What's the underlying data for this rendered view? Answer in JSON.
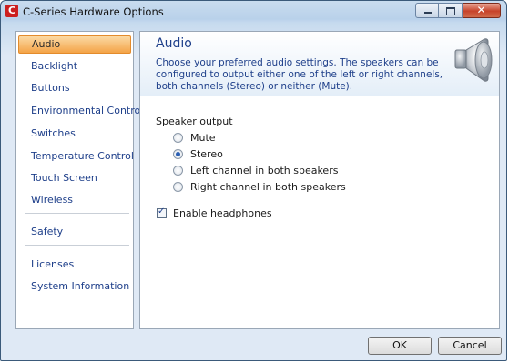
{
  "window": {
    "title": "C-Series Hardware Options",
    "app_icon_letter": "C"
  },
  "sidebar": {
    "items": [
      {
        "label": "Audio",
        "active": true
      },
      {
        "label": "Backlight"
      },
      {
        "label": "Buttons"
      },
      {
        "label": "Environmental Control"
      },
      {
        "label": "Switches"
      },
      {
        "label": "Temperature Control"
      },
      {
        "label": "Touch Screen"
      },
      {
        "label": "Wireless"
      },
      {
        "label": "Safety"
      },
      {
        "label": "Licenses"
      },
      {
        "label": "System Information"
      }
    ]
  },
  "content": {
    "title": "Audio",
    "description": "Choose your preferred audio settings. The speakers can be configured to output either one of the left or right channels, both channels (Stereo) or neither (Mute).",
    "speaker_output_label": "Speaker output",
    "options": [
      {
        "label": "Mute",
        "checked": false
      },
      {
        "label": "Stereo",
        "checked": true
      },
      {
        "label": "Left channel in both speakers",
        "checked": false
      },
      {
        "label": "Right channel in both speakers",
        "checked": false
      }
    ],
    "headphones": {
      "label": "Enable headphones",
      "checked": true
    }
  },
  "buttons": {
    "ok": "OK",
    "cancel": "Cancel"
  },
  "colors": {
    "accent_link": "#1e3f8a",
    "selection": "#f4a348",
    "close_button": "#c7432a"
  },
  "icons": {
    "app": "app-logo-icon",
    "header": "speaker-icon"
  }
}
